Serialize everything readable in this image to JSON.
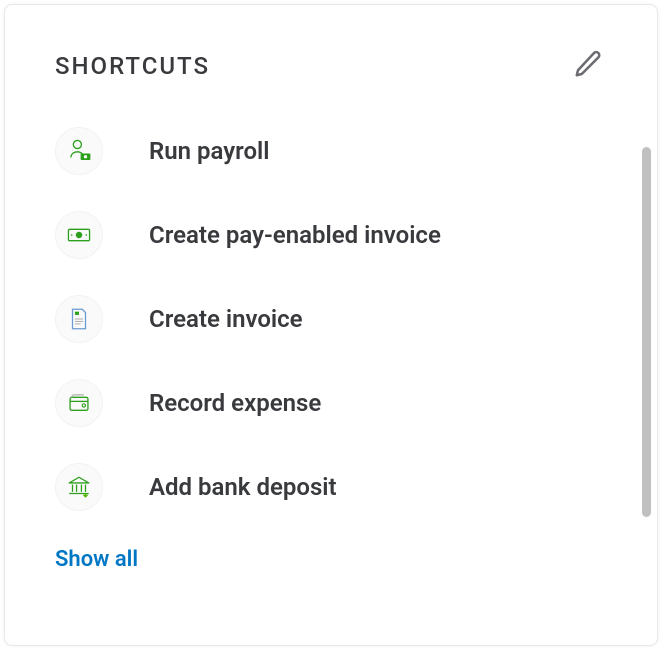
{
  "header": {
    "title": "SHORTCUTS"
  },
  "shortcuts": [
    {
      "icon": "person-card-icon",
      "label": "Run payroll"
    },
    {
      "icon": "cash-icon",
      "label": "Create pay-enabled invoice"
    },
    {
      "icon": "invoice-doc-icon",
      "label": "Create invoice"
    },
    {
      "icon": "wallet-icon",
      "label": "Record expense"
    },
    {
      "icon": "bank-icon",
      "label": "Add bank deposit"
    }
  ],
  "footer": {
    "show_all_label": "Show all"
  }
}
